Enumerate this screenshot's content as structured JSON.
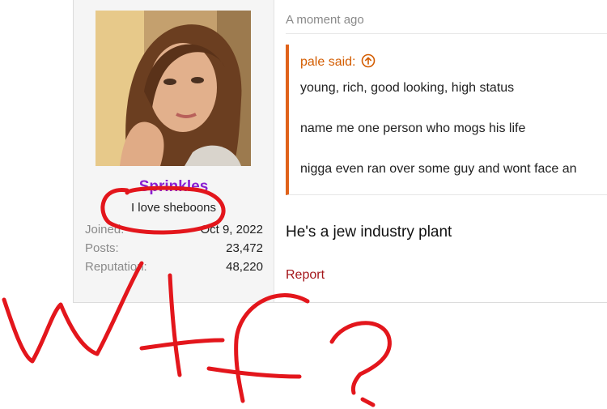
{
  "post": {
    "user": {
      "name": "Sprinkles",
      "title": "I love sheboons",
      "stats": [
        {
          "label": "Joined:",
          "value": "Oct 9, 2022"
        },
        {
          "label": "Posts:",
          "value": "23,472"
        },
        {
          "label": "Reputation:",
          "value": "48,220"
        }
      ]
    },
    "date": "A moment ago",
    "quote": {
      "header": "pale said:",
      "lines": [
        "young, rich, good looking, high status",
        "name me one person who mogs his life",
        "nigga even ran over some guy and wont face an"
      ]
    },
    "body": "He's a jew industry plant",
    "report_label": "Report"
  },
  "annotation": {
    "text": "Wtf?",
    "color": "#e3161c"
  },
  "colors": {
    "username": "#8a1fd2",
    "quote_accent": "#e0621a",
    "report": "#a4161a"
  }
}
